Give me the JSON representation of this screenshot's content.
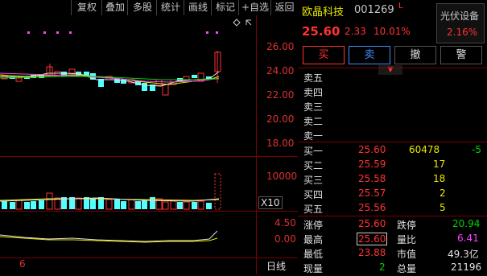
{
  "toolbar": {
    "items": [
      "复权",
      "叠加",
      "多股",
      "统计",
      "画线",
      "标记",
      "+自选",
      "返回"
    ]
  },
  "chart": {
    "price_axis": [
      "26.00",
      "24.00",
      "22.00",
      "20.00",
      "18.00"
    ],
    "volume_axis": [
      "10000"
    ],
    "volume_unit": "X10",
    "indicator_axis": [
      "4.50",
      "0.00"
    ],
    "period_label": "日线",
    "bottom_date": "6",
    "colors": {
      "up": "#ff3232",
      "down": "#54ffff",
      "ma5": "#e0e0e0",
      "ma10": "#e8e800",
      "ma20": "#ff40ff",
      "ma60": "#00d200",
      "grid": "#7a0000"
    }
  },
  "stock": {
    "name": "欧晶科技",
    "code": "001269",
    "flag": "L",
    "price": "25.60",
    "change": "2.33",
    "change_pct": "10.01%",
    "sector": "光伏设备",
    "sector_pct": "2.16%"
  },
  "actions": {
    "buy": "买",
    "sell": "卖",
    "cancel": "撤",
    "alert": "警"
  },
  "order_book": {
    "asks": [
      {
        "label": "卖五",
        "price": "",
        "vol": ""
      },
      {
        "label": "卖四",
        "price": "",
        "vol": ""
      },
      {
        "label": "卖三",
        "price": "",
        "vol": ""
      },
      {
        "label": "卖二",
        "price": "",
        "vol": ""
      },
      {
        "label": "卖一",
        "price": "",
        "vol": ""
      }
    ],
    "bids": [
      {
        "label": "买一",
        "price": "25.60",
        "vol": "60478",
        "chg": "-5"
      },
      {
        "label": "买二",
        "price": "25.59",
        "vol": "17",
        "chg": ""
      },
      {
        "label": "买三",
        "price": "25.58",
        "vol": "18",
        "chg": ""
      },
      {
        "label": "买四",
        "price": "25.57",
        "vol": "2",
        "chg": ""
      },
      {
        "label": "买五",
        "price": "25.56",
        "vol": "5",
        "chg": ""
      }
    ]
  },
  "stats": [
    {
      "l1": "涨停",
      "v1": "25.60",
      "l2": "跌停",
      "v2": "20.94"
    },
    {
      "l1": "最高",
      "v1": "25.60",
      "l2": "量比",
      "v2": "6.41"
    },
    {
      "l1": "最低",
      "v1": "23.88",
      "l2": "市值",
      "v2": "49.3亿"
    },
    {
      "l1": "现量",
      "v1": "2",
      "l2": "总量",
      "v2": "21196"
    }
  ]
}
